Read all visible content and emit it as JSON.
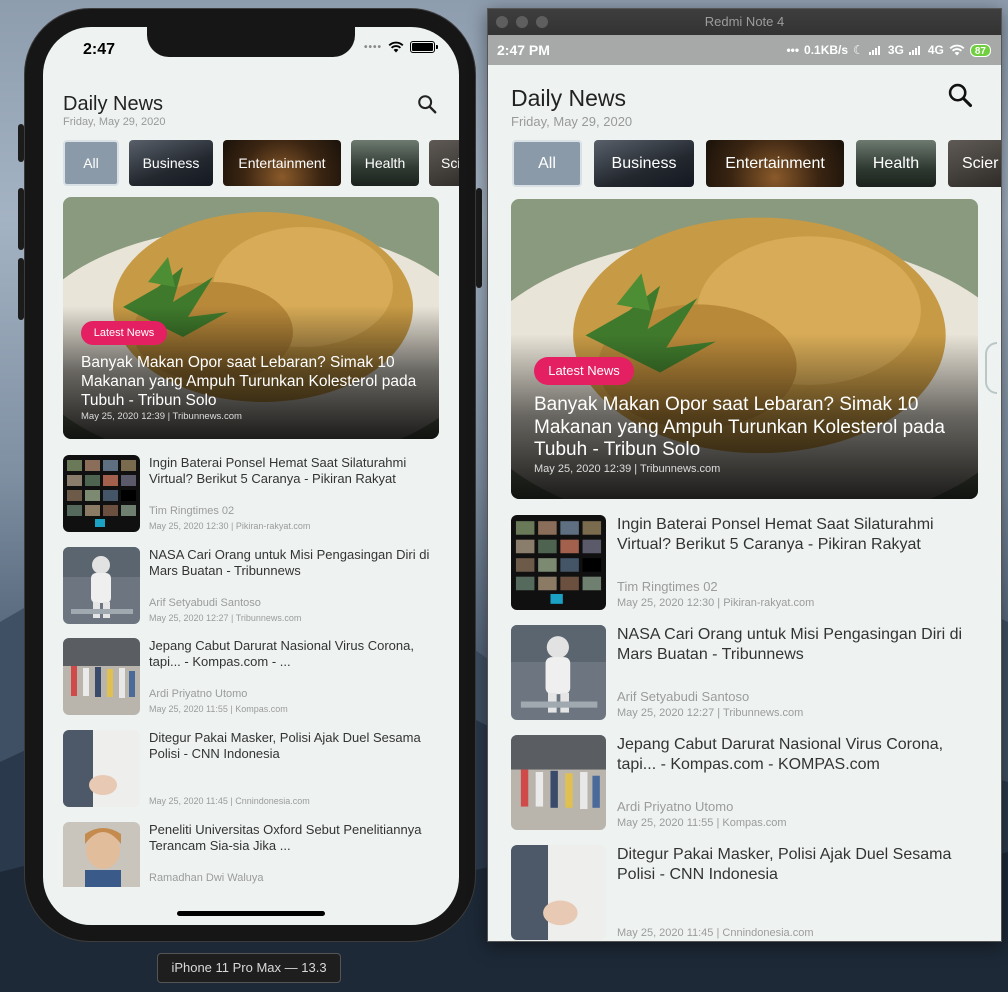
{
  "ios": {
    "status_time": "2:47",
    "device_label": "iPhone 11 Pro Max — 13.3"
  },
  "android": {
    "window_title": "Redmi Note 4",
    "status_time": "2:47 PM",
    "network_speed": "0.1KB/s",
    "net_3g": "3G",
    "net_4g": "4G",
    "battery": "87"
  },
  "app": {
    "title": "Daily News",
    "date": "Friday, May 29, 2020",
    "categories": [
      "All",
      "Business",
      "Entertainment",
      "Health",
      "Science"
    ],
    "categories_ios_visible": [
      "All",
      "Business",
      "Entertainment",
      "Health",
      "Sci"
    ],
    "categories_android_visible": [
      "All",
      "Business",
      "Entertainment",
      "Health",
      "Scier"
    ],
    "headline": {
      "badge": "Latest News",
      "title": "Banyak Makan Opor saat Lebaran? Simak 10 Makanan yang Ampuh Turunkan Kolesterol pada Tubuh - Tribun Solo",
      "meta": "May 25, 2020 12:39 | Tribunnews.com"
    },
    "articles": [
      {
        "title": "Ingin Baterai Ponsel Hemat Saat Silaturahmi Virtual? Berikut 5 Caranya - Pikiran Rakyat",
        "author": "Tim Ringtimes 02",
        "meta": "May 25, 2020 12:30 | Pikiran-rakyat.com"
      },
      {
        "title": "NASA Cari Orang untuk Misi Pengasingan Diri di Mars Buatan - Tribunnews",
        "author": "Arif Setyabudi Santoso",
        "meta": "May 25, 2020 12:27 | Tribunnews.com"
      },
      {
        "title_ios": "Jepang Cabut Darurat Nasional Virus Corona, tapi... - Kompas.com - ...",
        "title": "Jepang Cabut Darurat Nasional Virus Corona, tapi... - Kompas.com - KOMPAS.com",
        "author": "Ardi Priyatno Utomo",
        "meta": "May 25, 2020 11:55 | Kompas.com"
      },
      {
        "title": "Ditegur Pakai Masker, Polisi Ajak Duel Sesama Polisi - CNN Indonesia",
        "author": "",
        "meta": "May 25, 2020 11:45 | Cnnindonesia.com"
      },
      {
        "title_ios": "Peneliti Universitas Oxford Sebut Penelitiannya Terancam Sia-sia Jika ...",
        "author": "Ramadhan Dwi Waluya"
      }
    ]
  },
  "colors": {
    "badge": "#e41f62",
    "active_chip": "#8a9aa8",
    "app_bg": "#eef3f2",
    "android_battery": "#6fcf3e"
  },
  "icons": [
    "search-icon",
    "wifi-icon",
    "battery-icon",
    "signal-icon",
    "moon-icon"
  ]
}
